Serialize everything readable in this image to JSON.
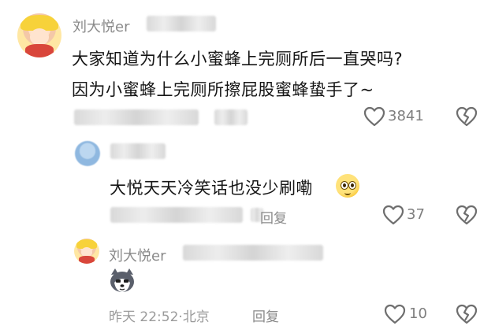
{
  "comment": {
    "author": "刘大悦er",
    "line1": "大家知道为什么小蜜蜂上完厕所后一直哭吗?",
    "line2": "因为小蜜蜂上完厕所擦屁股蜜蜂蛰手了~",
    "likes": "3841"
  },
  "reply1": {
    "text": "大悦天天冷笑话也没少刷嘞",
    "reply_label": "回复",
    "likes": "37"
  },
  "reply2": {
    "author": "刘大悦er",
    "time": "昨天 22:52",
    "location": "北京",
    "reply_label": "回复",
    "likes": "10"
  },
  "icons": {
    "like": "heart-outline-icon",
    "dislike": "broken-heart-icon",
    "emoji_face": "pleading-face-emoji-icon",
    "sticker": "husky-dog-sticker-icon"
  }
}
